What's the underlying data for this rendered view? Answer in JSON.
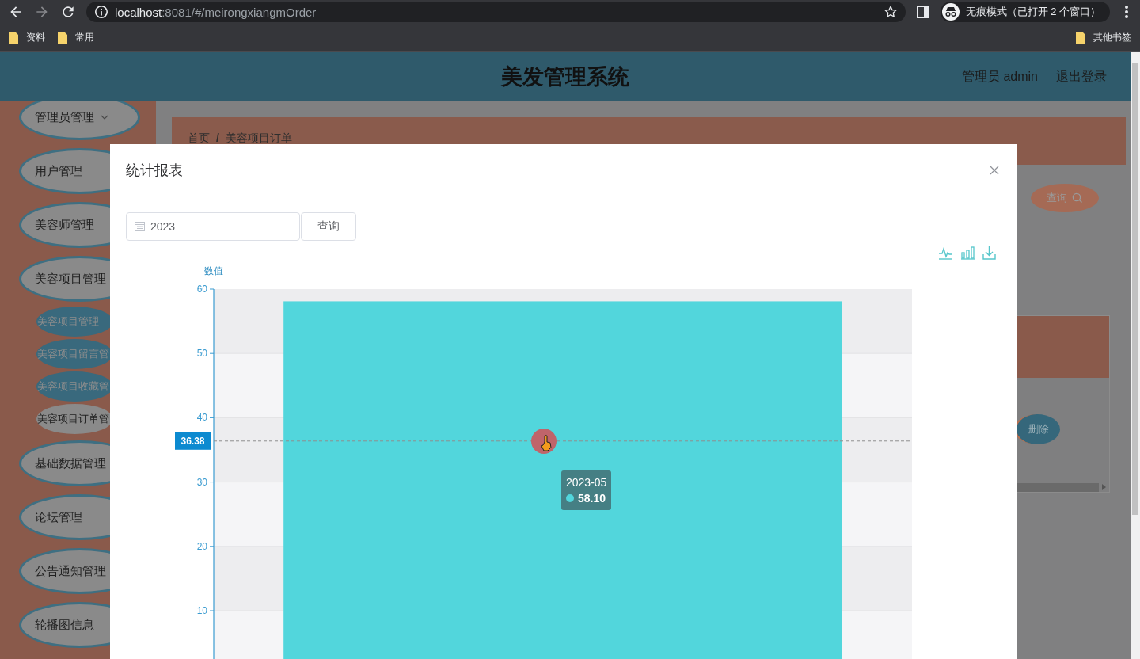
{
  "browser": {
    "address": {
      "host": "localhost",
      "path": ":8081/#/meirongxiangmOrder"
    },
    "profile_label": "无痕模式（已打开 2 个窗口）",
    "bookmarks": [
      {
        "label": "资料"
      },
      {
        "label": "常用"
      }
    ],
    "other_bookmarks": "其他书签"
  },
  "header": {
    "title": "美发管理系统",
    "user": "管理员 admin",
    "logout": "退出登录"
  },
  "sidebar": {
    "items": [
      {
        "label": "管理员管理",
        "chevron": true
      },
      {
        "label": "用户管理",
        "chevron": false
      },
      {
        "label": "美容师管理",
        "chevron": false
      },
      {
        "label": "美容项目管理",
        "chevron": false,
        "children": [
          {
            "label": "美容项目管理",
            "selected": false
          },
          {
            "label": "美容项目留言管",
            "selected": false
          },
          {
            "label": "美容项目收藏管",
            "selected": false
          },
          {
            "label": "美容项目订单管",
            "selected": true
          }
        ]
      },
      {
        "label": "基础数据管理",
        "chevron": false
      },
      {
        "label": "论坛管理",
        "chevron": false
      },
      {
        "label": "公告通知管理",
        "chevron": false
      },
      {
        "label": "轮播图信息",
        "chevron": false
      }
    ]
  },
  "content": {
    "breadcrumb": {
      "items": [
        "首页",
        "美容项目订单"
      ],
      "separator": "/"
    },
    "search_button": "查询",
    "delete_button": "删除"
  },
  "modal": {
    "title": "统计报表",
    "date_value": "2023",
    "query_button": "查询",
    "chart": {
      "axis_pointer_label": "36.38",
      "tooltip": {
        "value": "58.10"
      },
      "chart_data": {
        "type": "bar",
        "ylabel": "数值",
        "categories": [
          "2023-05"
        ],
        "series": [
          {
            "color": "#52d6dc",
            "values": [
              58.1
            ]
          }
        ],
        "ylim": [
          0,
          60
        ],
        "yticks": [
          10,
          20,
          30,
          40,
          50,
          60
        ],
        "grid": true,
        "ref_lines": [
          {
            "axis": "y",
            "value": 36.38
          }
        ]
      }
    }
  }
}
